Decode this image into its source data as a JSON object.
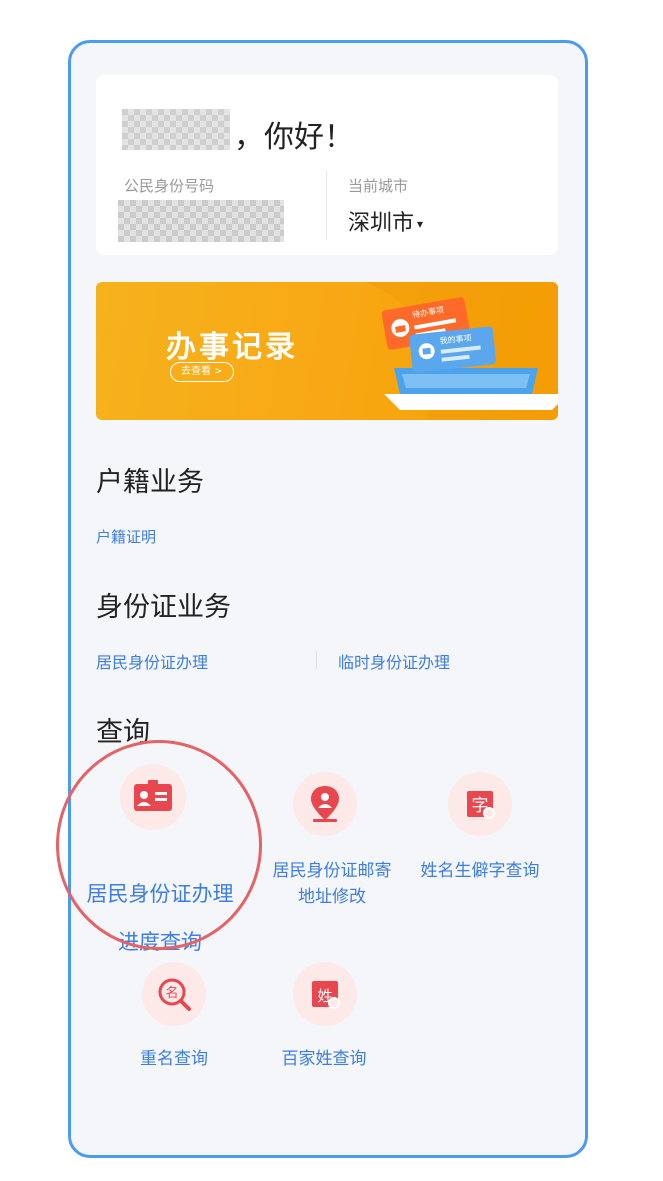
{
  "greeting": {
    "text": "，你好！"
  },
  "id_card": {
    "label": "公民身份号码"
  },
  "city": {
    "label": "当前城市",
    "value": "深圳市",
    "caret": "▾"
  },
  "banner": {
    "title": "办事记录",
    "button": "去查看 >",
    "tag1": "待办事项",
    "tag2": "我的事项"
  },
  "household": {
    "title": "户籍业务",
    "links": [
      "户籍证明"
    ]
  },
  "idcard_service": {
    "title": "身份证业务",
    "links": [
      "居民身份证办理",
      "临时身份证办理"
    ]
  },
  "query": {
    "title": "查询",
    "items": [
      {
        "line1": "居民身份证办理",
        "line2": "进度查询",
        "icon": "id-card-icon"
      },
      {
        "line1": "居民身份证邮寄",
        "line2": "地址修改",
        "icon": "location-person-icon"
      },
      {
        "line1": "姓名生僻字查询",
        "line2": "",
        "icon": "rare-character-icon",
        "glyph": "字"
      },
      {
        "line1": "重名查询",
        "line2": "",
        "icon": "duplicate-name-search-icon",
        "glyph": "名"
      },
      {
        "line1": "百家姓查询",
        "line2": "",
        "icon": "surname-icon",
        "glyph": "姓"
      }
    ]
  },
  "colors": {
    "accent": "#3d7ee0",
    "icon_red": "#e8474f",
    "banner": "#f8a916",
    "highlight": "#e56266"
  }
}
